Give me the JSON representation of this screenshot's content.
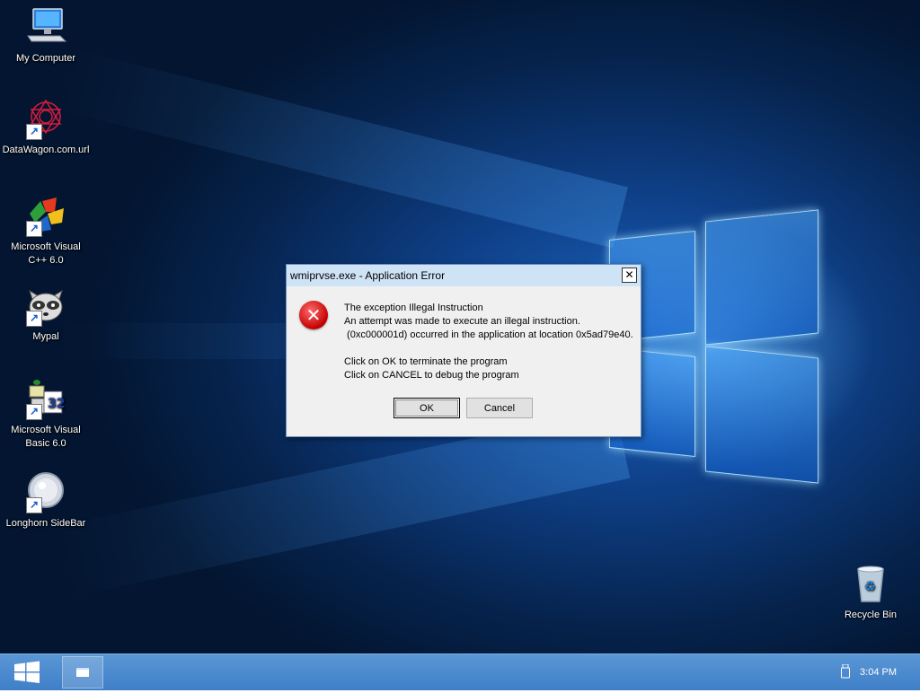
{
  "desktop": {
    "icons": [
      {
        "label": "My Computer",
        "icon": "computer-icon"
      },
      {
        "label": "DataWagon.com.url",
        "icon": "datawagon-icon"
      },
      {
        "label": "Microsoft Visual C++ 6.0",
        "icon": "visual-cpp-icon"
      },
      {
        "label": "Mypal",
        "icon": "mypal-raccoon-icon"
      },
      {
        "label": "Microsoft Visual Basic 6.0",
        "icon": "visual-basic-icon"
      },
      {
        "label": "Longhorn SideBar",
        "icon": "sidebar-icon"
      },
      {
        "label": "Recycle Bin",
        "icon": "recycle-bin-icon"
      }
    ]
  },
  "dialog": {
    "title": "wmiprvse.exe - Application Error",
    "close_glyph": "✕",
    "icon": "error-icon",
    "message_lines": [
      "The exception Illegal Instruction",
      "An attempt was made to execute an illegal instruction.",
      " (0xc000001d) occurred in the application at location 0x5ad79e40.",
      "",
      "Click on OK to terminate the program",
      "Click on CANCEL to debug the program"
    ],
    "ok_label": "OK",
    "cancel_label": "Cancel"
  },
  "taskbar": {
    "start_icon": "windows-logo-icon",
    "app_icon": "window-icon",
    "tray_icon": "usb-drive-icon",
    "clock": "3:04 PM"
  },
  "colors": {
    "taskbar": "#4a8ad0",
    "titlebar": "#cfe3f7",
    "dialog_bg": "#f0f0f0",
    "error_red": "#c40000"
  }
}
